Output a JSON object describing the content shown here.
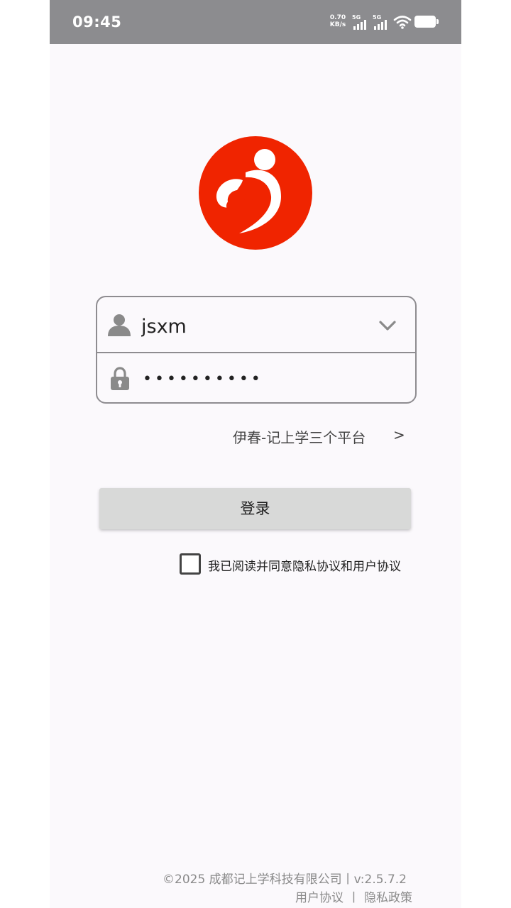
{
  "status_bar": {
    "time": "09:45",
    "net_speed_value": "0.70",
    "net_speed_unit": "KB/s",
    "signal_1_label": "5G",
    "signal_2_label": "5G",
    "icons": [
      "signal-icon",
      "wifi-icon",
      "battery-icon"
    ]
  },
  "logo": {
    "icon": "app-logo",
    "color": "#f02400"
  },
  "login": {
    "username_value": "jsxm",
    "password_value": "••••••••••",
    "icons": {
      "user": "user-icon",
      "lock": "lock-icon",
      "dropdown": "chevron-down-icon"
    }
  },
  "platform_link": {
    "label": "伊春-记上学三个平台",
    "chevron": ">"
  },
  "login_button": {
    "label": "登录",
    "color": "#d8d9d8"
  },
  "agreement": {
    "label": "我已阅读并同意隐私协议和用户协议",
    "checked": false
  },
  "footer": {
    "copyright": "©2025 成都记上学科技有限公司丨v:2.5.7.2",
    "user_agreement": "用户协议",
    "separator": "丨",
    "privacy_policy": "隐私政策"
  },
  "colors": {
    "status_bar": "#8c8c8f",
    "background": "#fbf9fc",
    "accent_red": "#f02400"
  }
}
